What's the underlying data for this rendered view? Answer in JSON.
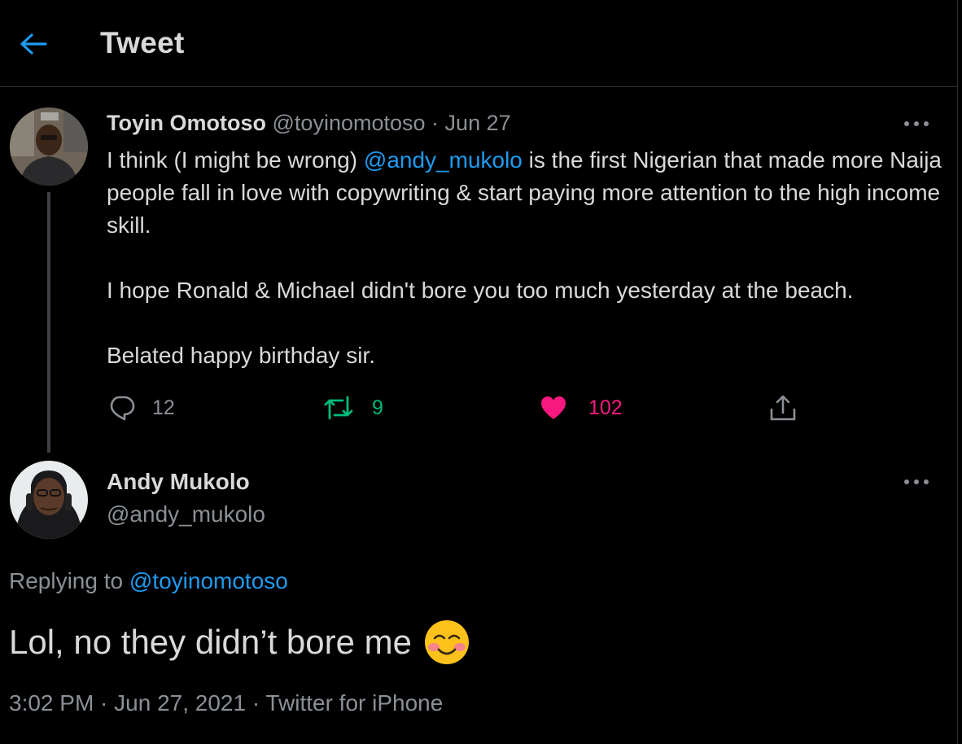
{
  "header": {
    "title": "Tweet"
  },
  "parent_tweet": {
    "author_name": "Toyin Omotoso",
    "author_handle": "@toyinomotoso",
    "separator": "·",
    "date": "Jun 27",
    "body_start": "I think (I might be wrong) ",
    "body_mention": "@andy_mukolo",
    "body_rest": " is the first Nigerian that made more Naija people fall in love with copywriting & start paying more attention to the high income skill.",
    "paragraph2": "I hope Ronald & Michael didn't bore you too much yesterday at the beach.",
    "paragraph3": "Belated happy birthday sir.",
    "replies": "12",
    "retweets": "9",
    "likes": "102"
  },
  "main_tweet": {
    "author_name": "Andy Mukolo",
    "author_handle": "@andy_mukolo",
    "replying_label": "Replying to ",
    "replying_to": "@toyinomotoso",
    "text": "Lol, no they didn’t bore me",
    "emoji": "smiling-face-with-blush-emoji",
    "meta": "3:02 PM · Jun 27, 2021 · Twitter for iPhone"
  },
  "colors": {
    "accent": "#1d9bf0",
    "retweet": "#00ba7c",
    "like": "#f91880",
    "muted": "#8b9096",
    "text": "#d9d9d9",
    "background": "#000000"
  }
}
